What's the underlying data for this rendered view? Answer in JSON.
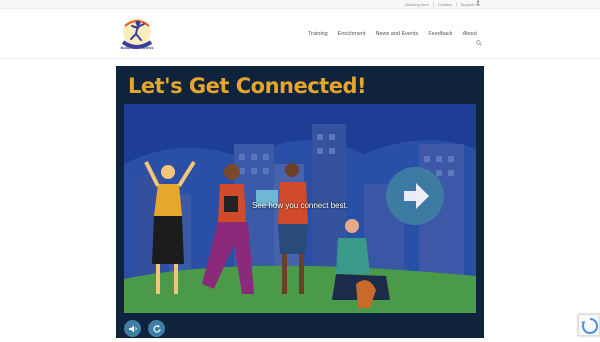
{
  "topbar": {
    "links": [
      "Booking form",
      "Contact",
      "Support us"
    ],
    "social_icon": "facebook-icon"
  },
  "header": {
    "logo_text": "Nullarbor Fitness",
    "nav": [
      "Training",
      "Enrichment",
      "News and Events",
      "Feedback",
      "About"
    ],
    "search_icon": "search-icon"
  },
  "panel": {
    "title": "Let's Get Connected!",
    "caption": "See how you connect best.",
    "next_icon": "arrow-right-icon",
    "audio_icon": "speaker-icon",
    "replay_icon": "replay-icon"
  },
  "colors": {
    "panel_bg": "#10233d",
    "title": "#e4a52b",
    "accent_button": "#3e7fa3",
    "scene_sky": "#1a3a8f",
    "grass": "#4a9a4a"
  }
}
